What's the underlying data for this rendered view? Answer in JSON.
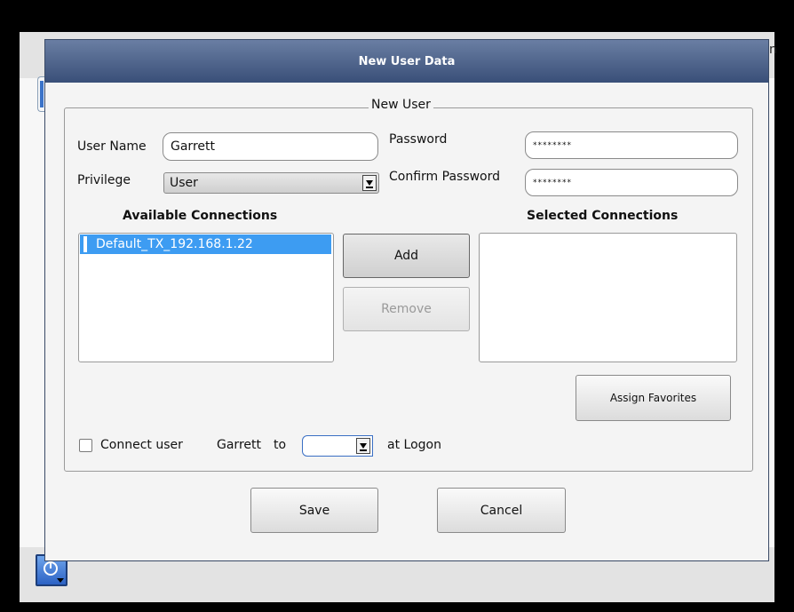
{
  "background": {
    "partial_text": "n",
    "icons": [
      "power-icon"
    ]
  },
  "dialog": {
    "title": "New User Data",
    "group_title": "New User",
    "user_name": {
      "label": "User Name",
      "value": "Garrett"
    },
    "password": {
      "label": "Password",
      "value": "********"
    },
    "privilege": {
      "label": "Privilege",
      "selected": "User"
    },
    "confirm_password": {
      "label": "Confirm Password",
      "value": "********"
    },
    "available": {
      "header": "Available Connections",
      "items": [
        "Default_TX_192.168.1.22"
      ]
    },
    "selected": {
      "header": "Selected Connections",
      "items": []
    },
    "buttons": {
      "add": "Add",
      "remove": "Remove",
      "assign_favorites": "Assign Favorites",
      "save": "Save",
      "cancel": "Cancel"
    },
    "connect": {
      "checkbox_label": "Connect user",
      "user": "Garrett",
      "to": "to",
      "selected": "",
      "suffix": "at Logon"
    }
  },
  "colors": {
    "title_bar": "#394f78",
    "selection": "#3d9cf2",
    "icon_button": "#2c62c4"
  }
}
